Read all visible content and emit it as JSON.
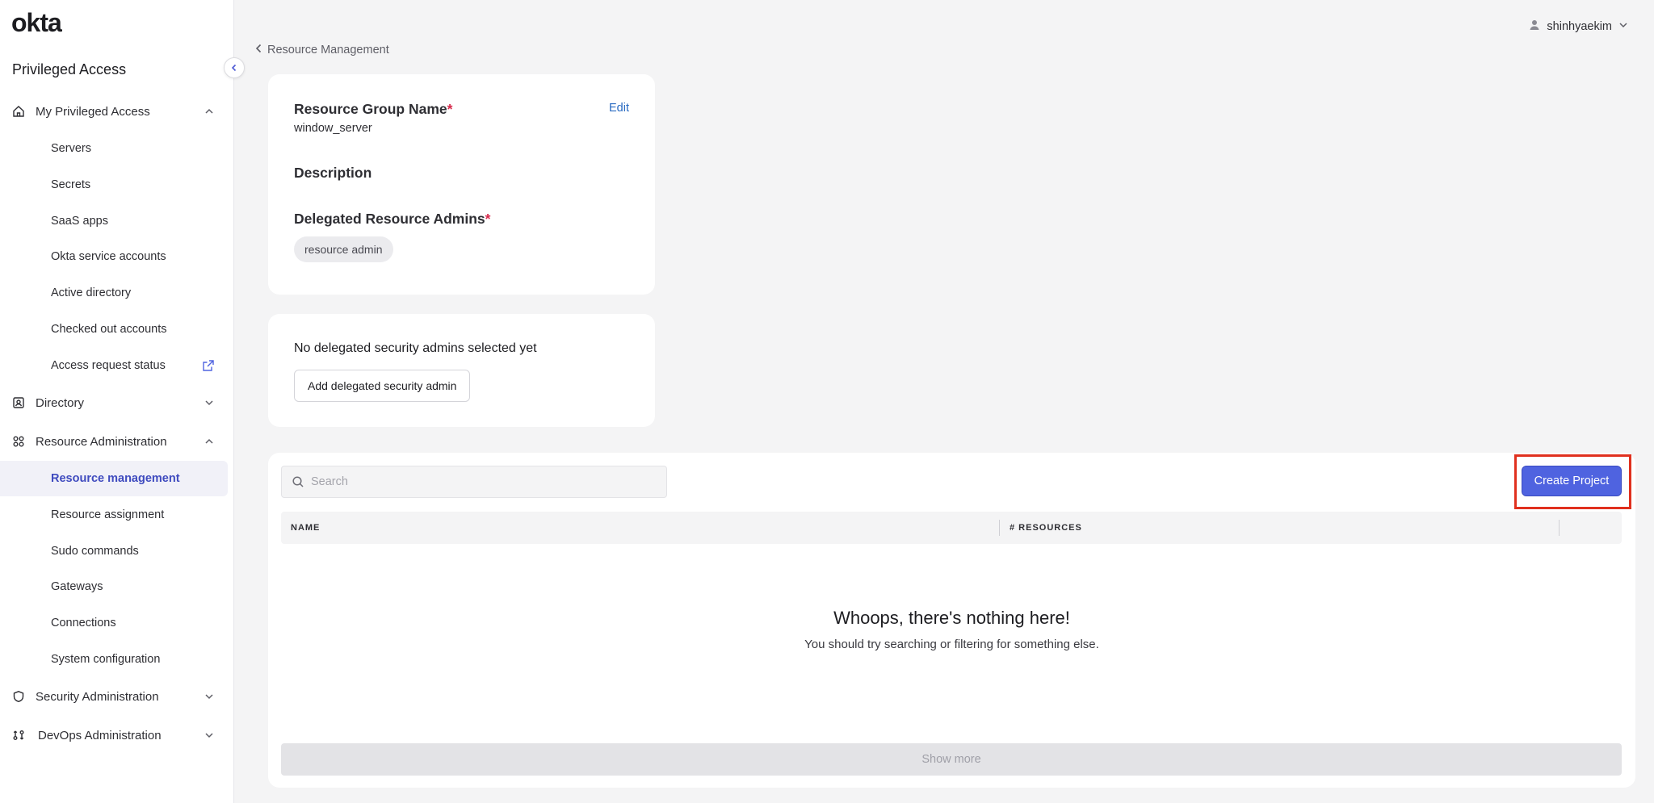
{
  "app": {
    "logo_text": "okta",
    "product_title": "Privileged Access"
  },
  "sidebar": {
    "sections": {
      "my_access": {
        "label": "My Privileged Access",
        "icon": "home-icon",
        "expanded": true
      },
      "directory": {
        "label": "Directory",
        "icon": "directory-icon",
        "expanded": false
      },
      "resource_admin": {
        "label": "Resource Administration",
        "icon": "grid-icon",
        "expanded": true
      },
      "security_admin": {
        "label": "Security Administration",
        "icon": "shield-icon",
        "expanded": false
      },
      "devops_admin": {
        "label": "DevOps Administration",
        "icon": "devops-icon",
        "expanded": false
      }
    },
    "my_access_items": [
      "Servers",
      "Secrets",
      "SaaS apps",
      "Okta service accounts",
      "Active directory",
      "Checked out accounts",
      "Access request status"
    ],
    "resource_admin_items": [
      "Resource management",
      "Resource assignment",
      "Sudo commands",
      "Gateways",
      "Connections",
      "System configuration"
    ],
    "active_item": "Resource management"
  },
  "header": {
    "username": "shinhyaekim"
  },
  "breadcrumb": {
    "back_label": "Resource Management"
  },
  "resource_group": {
    "name_label": "Resource Group Name",
    "name_value": "window_server",
    "edit_label": "Edit",
    "description_label": "Description",
    "admins_label": "Delegated Resource Admins",
    "admins": [
      "resource admin"
    ],
    "required_marker": "*"
  },
  "security_admins": {
    "empty_text": "No delegated security admins selected yet",
    "add_button_label": "Add delegated security admin"
  },
  "projects": {
    "search_placeholder": "Search",
    "create_button_label": "Create Project",
    "columns": [
      "NAME",
      "# RESOURCES"
    ],
    "rows": [],
    "empty_title": "Whoops, there's nothing here!",
    "empty_subtitle": "You should try searching or filtering for something else.",
    "show_more_label": "Show more"
  },
  "colors": {
    "accent": "#4f63e0",
    "active_nav": "#3f4bbf",
    "required": "#d6284a",
    "highlight": "#e0301e"
  }
}
